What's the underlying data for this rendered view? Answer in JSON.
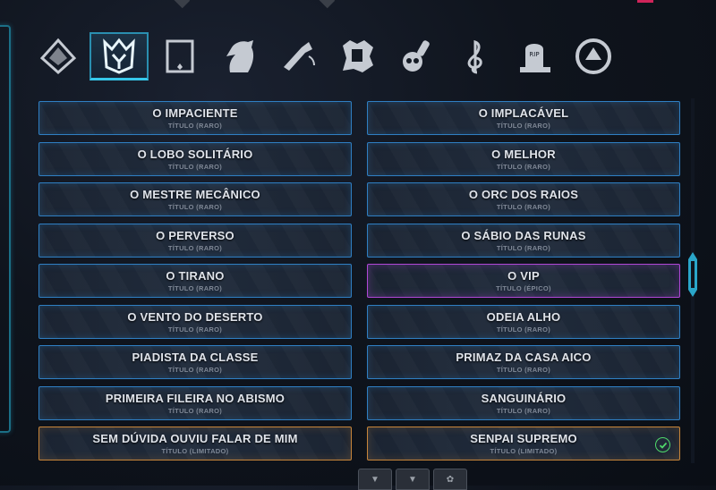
{
  "tabs": [
    {
      "icon": "crystal-pyramid-icon",
      "active": false
    },
    {
      "icon": "crown-emblem-icon",
      "active": true
    },
    {
      "icon": "card-frame-icon",
      "active": false
    },
    {
      "icon": "horse-head-icon",
      "active": false
    },
    {
      "icon": "war-horn-icon",
      "active": false
    },
    {
      "icon": "torn-banner-icon",
      "active": false
    },
    {
      "icon": "skull-brush-icon",
      "active": false
    },
    {
      "icon": "treble-clef-icon",
      "active": false
    },
    {
      "icon": "tombstone-rip-icon",
      "active": false
    },
    {
      "icon": "round-emblem-icon",
      "active": false
    }
  ],
  "tombstone_text": "RIP",
  "titles": [
    {
      "name": "O IMPACIENTE",
      "sub": "TÍTULO (RARO)",
      "rarity": "rare"
    },
    {
      "name": "O IMPLACÁVEL",
      "sub": "TÍTULO (RARO)",
      "rarity": "rare"
    },
    {
      "name": "O LOBO SOLITÁRIO",
      "sub": "TÍTULO (RARO)",
      "rarity": "rare"
    },
    {
      "name": "O MELHOR",
      "sub": "TÍTULO (RARO)",
      "rarity": "rare"
    },
    {
      "name": "O MESTRE MECÂNICO",
      "sub": "TÍTULO (RARO)",
      "rarity": "rare"
    },
    {
      "name": "O ORC DOS RAIOS",
      "sub": "TÍTULO (RARO)",
      "rarity": "rare"
    },
    {
      "name": "O PERVERSO",
      "sub": "TÍTULO (RARO)",
      "rarity": "rare"
    },
    {
      "name": "O SÁBIO DAS RUNAS",
      "sub": "TÍTULO (RARO)",
      "rarity": "rare"
    },
    {
      "name": "O TIRANO",
      "sub": "TÍTULO (RARO)",
      "rarity": "rare"
    },
    {
      "name": "O VIP",
      "sub": "TÍTULO (ÉPICO)",
      "rarity": "epic"
    },
    {
      "name": "O VENTO DO DESERTO",
      "sub": "TÍTULO (RARO)",
      "rarity": "rare"
    },
    {
      "name": "ODEIA ALHO",
      "sub": "TÍTULO (RARO)",
      "rarity": "rare"
    },
    {
      "name": "PIADISTA DA CLASSE",
      "sub": "TÍTULO (RARO)",
      "rarity": "rare"
    },
    {
      "name": "PRIMAZ DA CASA AICO",
      "sub": "TÍTULO (RARO)",
      "rarity": "rare"
    },
    {
      "name": "PRIMEIRA FILEIRA NO ABISMO",
      "sub": "TÍTULO (RARO)",
      "rarity": "rare"
    },
    {
      "name": "SANGUINÁRIO",
      "sub": "TÍTULO (RARO)",
      "rarity": "rare"
    },
    {
      "name": "SEM DÚVIDA OUVIU FALAR DE MIM",
      "sub": "TÍTULO (LIMITADO)",
      "rarity": "limited"
    },
    {
      "name": "SENPAI SUPREMO",
      "sub": "TÍTULO (LIMITADO)",
      "rarity": "limited",
      "equipped": true
    }
  ],
  "colors": {
    "rare_border": "#2f7fc3",
    "epic_border": "#b047d6",
    "limited_border": "#c7853a",
    "active_tab": "#36c8ea",
    "equipped_check": "#4fd96b"
  },
  "bottom_tabs": [
    {
      "icon": "mini-emblem-icon"
    },
    {
      "icon": "mini-emblem-icon"
    },
    {
      "icon": "mini-gear-icon"
    }
  ]
}
